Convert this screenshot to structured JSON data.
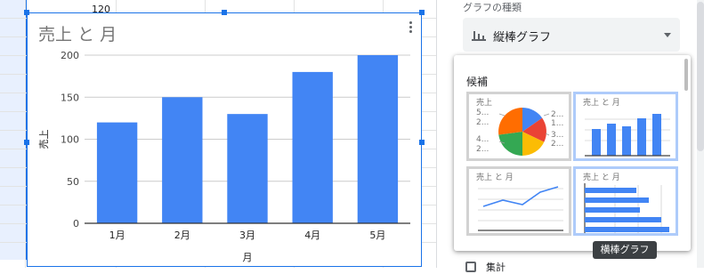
{
  "sheet": {
    "visible_cell_value": "120"
  },
  "chart": {
    "title": "売上 と 月",
    "menu_icon": "more-vert-icon",
    "selected": true
  },
  "chart_data": {
    "type": "bar",
    "title": "売上 と 月",
    "xlabel": "月",
    "ylabel": "売上",
    "categories": [
      "1月",
      "2月",
      "3月",
      "4月",
      "5月"
    ],
    "values": [
      120,
      150,
      130,
      180,
      200
    ],
    "ylim": [
      0,
      200
    ],
    "yticks": [
      "0",
      "50",
      "100",
      "150",
      "200"
    ],
    "grid": true,
    "bar_color": "#4285f4"
  },
  "panel": {
    "chart_type_label": "グラフの種類",
    "chart_type_value": "縦棒グラフ",
    "chart_type_icon": "column-chart-icon",
    "suggestions_title": "候補",
    "suggestions": [
      {
        "kind": "pie",
        "title": "売上",
        "left_labels": [
          "5...",
          "2...",
          "4...",
          "2..."
        ],
        "right_labels": [
          "2...",
          "1...",
          "3...",
          "2..."
        ]
      },
      {
        "kind": "column",
        "title": "売上 と 月",
        "selected": true
      },
      {
        "kind": "line",
        "title": "売上 と 月"
      },
      {
        "kind": "bar",
        "title": "売上 と 月",
        "hovered": true
      }
    ],
    "tooltip": "横棒グラフ",
    "aggregate_label": "集計"
  },
  "colors": {
    "accent": "#1a73e8",
    "bar": "#4285f4",
    "pie": [
      "#4285f4",
      "#ea4335",
      "#fbbc04",
      "#34a853",
      "#ff6d01"
    ]
  }
}
